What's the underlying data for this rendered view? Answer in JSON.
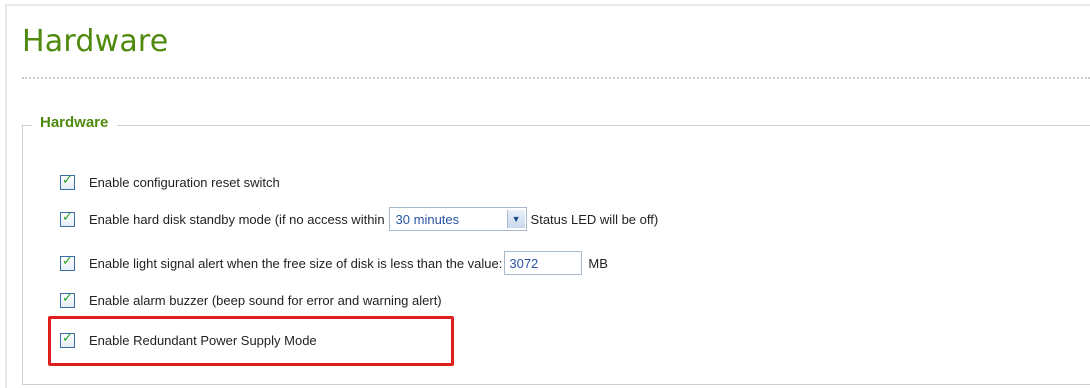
{
  "page": {
    "title": "Hardware"
  },
  "section": {
    "legend": "Hardware"
  },
  "options": [
    {
      "label": "Enable configuration reset switch",
      "checked": true
    },
    {
      "label_before": "Enable hard disk standby mode (if no access within",
      "select_value": "30 minutes",
      "label_after": "Status LED will be off)",
      "checked": true
    },
    {
      "label_before": "Enable light signal alert when the free size of disk is less than the value:",
      "input_value": "3072",
      "unit": "MB",
      "checked": true
    },
    {
      "label": "Enable alarm buzzer (beep sound for error and warning alert)",
      "checked": true
    },
    {
      "label": "Enable Redundant Power Supply Mode",
      "checked": true
    }
  ],
  "icons": {
    "checkbox_tick": "checkmark-icon",
    "select_arrow": "chevron-down-icon"
  },
  "colors": {
    "title_green": "#4f8a0f",
    "highlight_red": "#e01e1e",
    "value_blue": "#2a55a8"
  }
}
